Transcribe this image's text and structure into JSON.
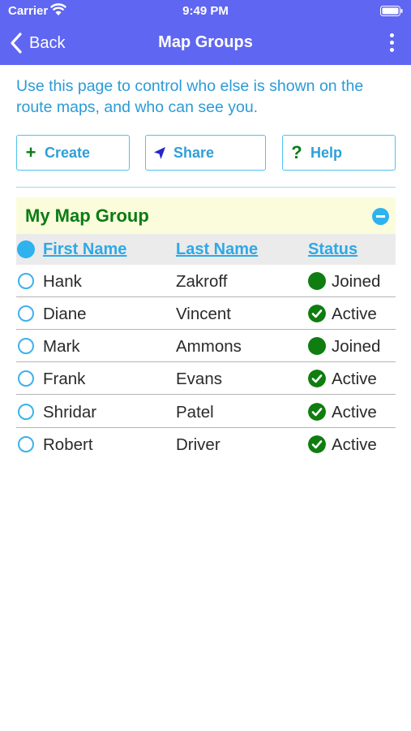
{
  "status_bar": {
    "carrier": "Carrier",
    "time": "9:49 PM"
  },
  "nav": {
    "back_label": "Back",
    "title": "Map Groups"
  },
  "intro": "Use this page to control who else is shown on the route maps, and who can see you.",
  "buttons": {
    "create": {
      "glyph": "+",
      "label": "Create"
    },
    "share": {
      "label": "Share"
    },
    "help": {
      "glyph": "?",
      "label": "Help"
    }
  },
  "group": {
    "title": "My Map Group",
    "columns": {
      "first": "First Name",
      "last": "Last Name",
      "status": "Status"
    },
    "members": [
      {
        "first": "Hank",
        "last": "Zakroff",
        "status": "Joined",
        "icon": "green-dot-icon"
      },
      {
        "first": "Diane",
        "last": "Vincent",
        "status": "Active",
        "icon": "checkmark-circle-icon"
      },
      {
        "first": "Mark",
        "last": "Ammons",
        "status": "Joined",
        "icon": "green-dot-icon"
      },
      {
        "first": "Frank",
        "last": "Evans",
        "status": "Active",
        "icon": "checkmark-circle-icon"
      },
      {
        "first": "Shridar",
        "last": "Patel",
        "status": "Active",
        "icon": "checkmark-circle-icon"
      },
      {
        "first": "Robert",
        "last": "Driver",
        "status": "Active",
        "icon": "checkmark-circle-icon"
      }
    ]
  },
  "colors": {
    "header": "#5f66f1",
    "accent": "#2fb2ee",
    "group_title": "#0a7c14",
    "status_icon": "#0f7d0f",
    "share_icon": "#2626c9"
  }
}
